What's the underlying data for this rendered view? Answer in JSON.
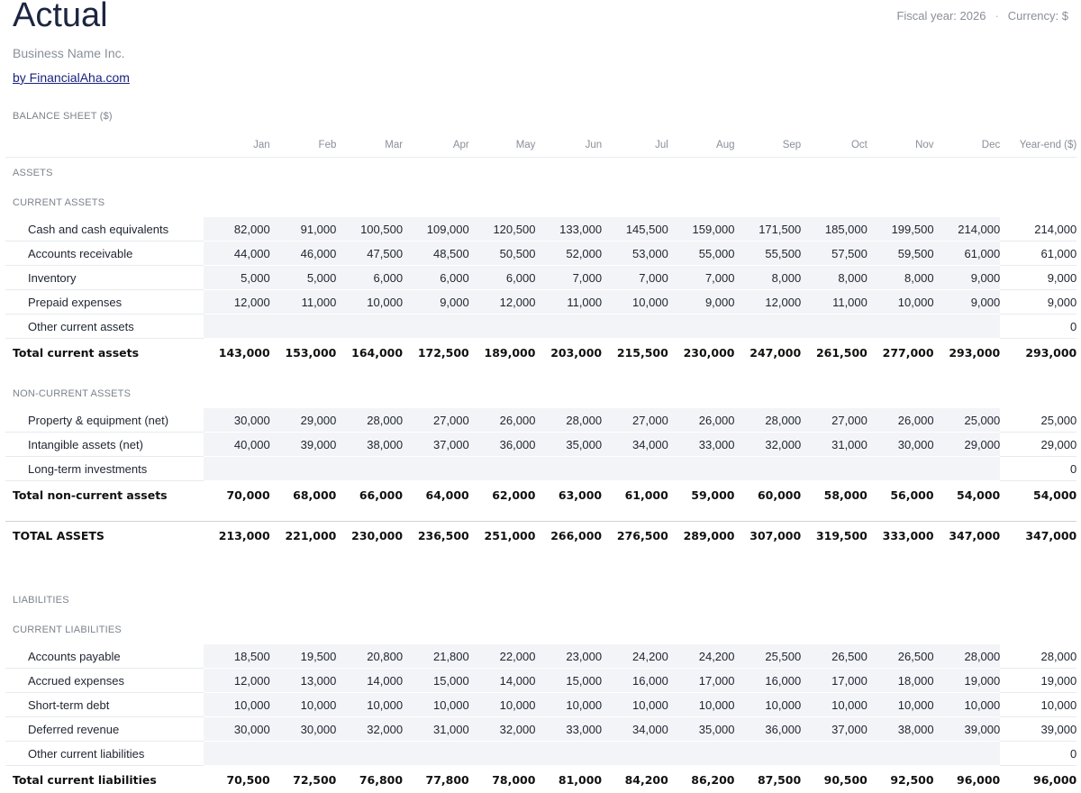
{
  "header": {
    "title": "Actual",
    "fiscal_year": "Fiscal year: 2026",
    "separator": "·",
    "currency": "Currency: $",
    "business_name": "Business Name Inc.",
    "byline": "by FinancialAha.com"
  },
  "sheet": {
    "section_label": "BALANCE SHEET ($)",
    "columns": [
      "Jan",
      "Feb",
      "Mar",
      "Apr",
      "May",
      "Jun",
      "Jul",
      "Aug",
      "Sep",
      "Oct",
      "Nov",
      "Dec",
      "Year-end ($)"
    ],
    "assets_label": "ASSETS",
    "current_assets_label": "CURRENT ASSETS",
    "current_assets": [
      {
        "label": "Cash and cash equivalents",
        "values": [
          "82,000",
          "91,000",
          "100,500",
          "109,000",
          "120,500",
          "133,000",
          "145,500",
          "159,000",
          "171,500",
          "185,000",
          "199,500",
          "214,000",
          "214,000"
        ]
      },
      {
        "label": "Accounts receivable",
        "values": [
          "44,000",
          "46,000",
          "47,500",
          "48,500",
          "50,500",
          "52,000",
          "53,000",
          "55,000",
          "55,500",
          "57,500",
          "59,500",
          "61,000",
          "61,000"
        ]
      },
      {
        "label": "Inventory",
        "values": [
          "5,000",
          "5,000",
          "6,000",
          "6,000",
          "6,000",
          "7,000",
          "7,000",
          "7,000",
          "8,000",
          "8,000",
          "8,000",
          "9,000",
          "9,000"
        ]
      },
      {
        "label": "Prepaid expenses",
        "values": [
          "12,000",
          "11,000",
          "10,000",
          "9,000",
          "12,000",
          "11,000",
          "10,000",
          "9,000",
          "12,000",
          "11,000",
          "10,000",
          "9,000",
          "9,000"
        ]
      },
      {
        "label": "Other current assets",
        "values": [
          "",
          "",
          "",
          "",
          "",
          "",
          "",
          "",
          "",
          "",
          "",
          "",
          "0"
        ]
      }
    ],
    "total_current_assets": {
      "label": "Total current assets",
      "values": [
        "143,000",
        "153,000",
        "164,000",
        "172,500",
        "189,000",
        "203,000",
        "215,500",
        "230,000",
        "247,000",
        "261,500",
        "277,000",
        "293,000",
        "293,000"
      ]
    },
    "non_current_assets_label": "NON-CURRENT ASSETS",
    "non_current_assets": [
      {
        "label": "Property & equipment (net)",
        "values": [
          "30,000",
          "29,000",
          "28,000",
          "27,000",
          "26,000",
          "28,000",
          "27,000",
          "26,000",
          "28,000",
          "27,000",
          "26,000",
          "25,000",
          "25,000"
        ]
      },
      {
        "label": "Intangible assets (net)",
        "values": [
          "40,000",
          "39,000",
          "38,000",
          "37,000",
          "36,000",
          "35,000",
          "34,000",
          "33,000",
          "32,000",
          "31,000",
          "30,000",
          "29,000",
          "29,000"
        ]
      },
      {
        "label": "Long-term investments",
        "values": [
          "",
          "",
          "",
          "",
          "",
          "",
          "",
          "",
          "",
          "",
          "",
          "",
          "0"
        ]
      }
    ],
    "total_non_current_assets": {
      "label": "Total non-current assets",
      "values": [
        "70,000",
        "68,000",
        "66,000",
        "64,000",
        "62,000",
        "63,000",
        "61,000",
        "59,000",
        "60,000",
        "58,000",
        "56,000",
        "54,000",
        "54,000"
      ]
    },
    "total_assets": {
      "label": "TOTAL ASSETS",
      "values": [
        "213,000",
        "221,000",
        "230,000",
        "236,500",
        "251,000",
        "266,000",
        "276,500",
        "289,000",
        "307,000",
        "319,500",
        "333,000",
        "347,000",
        "347,000"
      ]
    },
    "liabilities_label": "LIABILITIES",
    "current_liabilities_label": "CURRENT LIABILITIES",
    "current_liabilities": [
      {
        "label": "Accounts payable",
        "values": [
          "18,500",
          "19,500",
          "20,800",
          "21,800",
          "22,000",
          "23,000",
          "24,200",
          "24,200",
          "25,500",
          "26,500",
          "26,500",
          "28,000",
          "28,000"
        ]
      },
      {
        "label": "Accrued expenses",
        "values": [
          "12,000",
          "13,000",
          "14,000",
          "15,000",
          "14,000",
          "15,000",
          "16,000",
          "17,000",
          "16,000",
          "17,000",
          "18,000",
          "19,000",
          "19,000"
        ]
      },
      {
        "label": "Short-term debt",
        "values": [
          "10,000",
          "10,000",
          "10,000",
          "10,000",
          "10,000",
          "10,000",
          "10,000",
          "10,000",
          "10,000",
          "10,000",
          "10,000",
          "10,000",
          "10,000"
        ]
      },
      {
        "label": "Deferred revenue",
        "values": [
          "30,000",
          "30,000",
          "32,000",
          "31,000",
          "32,000",
          "33,000",
          "34,000",
          "35,000",
          "36,000",
          "37,000",
          "38,000",
          "39,000",
          "39,000"
        ]
      },
      {
        "label": "Other current liabilities",
        "values": [
          "",
          "",
          "",
          "",
          "",
          "",
          "",
          "",
          "",
          "",
          "",
          "",
          "0"
        ]
      }
    ],
    "total_current_liabilities": {
      "label": "Total current liabilities",
      "values": [
        "70,500",
        "72,500",
        "76,800",
        "77,800",
        "78,000",
        "81,000",
        "84,200",
        "86,200",
        "87,500",
        "90,500",
        "92,500",
        "96,000",
        "96,000"
      ]
    }
  }
}
